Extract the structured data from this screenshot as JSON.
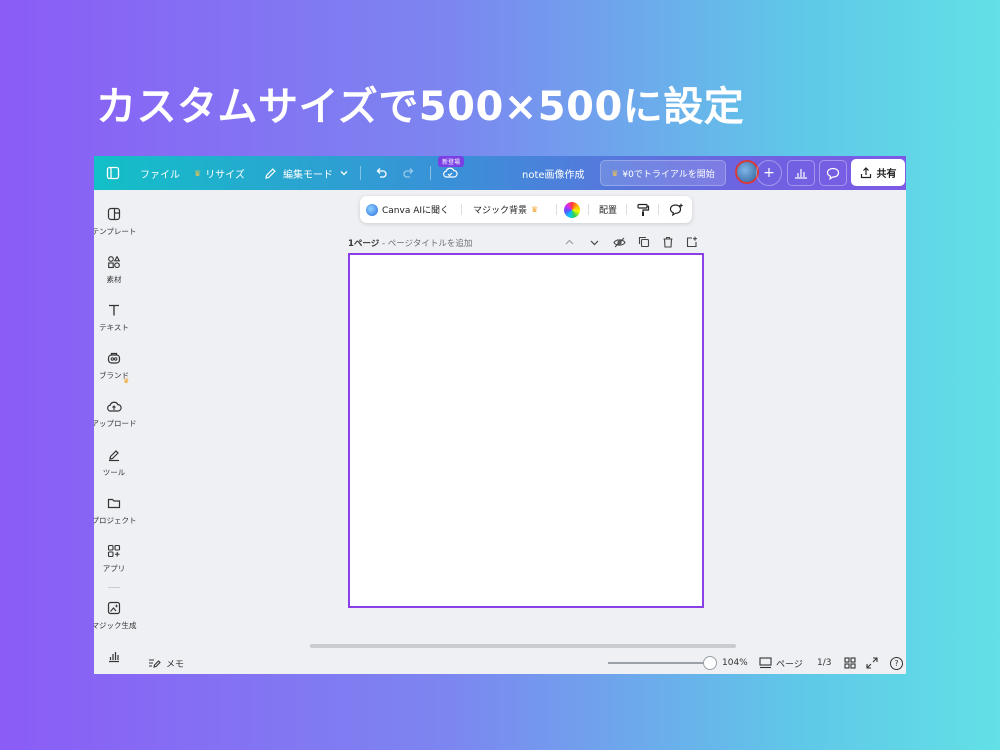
{
  "headline": "カスタムサイズで500×500に設定",
  "topbar": {
    "file": "ファイル",
    "resize": "リサイズ",
    "edit_mode": "編集モード",
    "new_badge": "新登場",
    "doc_title": "note画像作成",
    "trial": "¥0でトライアルを開始",
    "share": "共有"
  },
  "float_bar": {
    "canva_ai": "Canva AIに聞く",
    "magic_bg": "マジック背景",
    "arrange": "配置"
  },
  "page": {
    "label": "1ページ",
    "title_placeholder": "- ページタイトルを追加"
  },
  "sidebar": {
    "items": [
      {
        "label": "テンプレート",
        "icon": "template-icon"
      },
      {
        "label": "素材",
        "icon": "elements-icon"
      },
      {
        "label": "テキスト",
        "icon": "text-icon"
      },
      {
        "label": "ブランド",
        "icon": "brand-icon"
      },
      {
        "label": "アップロード",
        "icon": "upload-icon"
      },
      {
        "label": "ツール",
        "icon": "tool-icon"
      },
      {
        "label": "プロジェクト",
        "icon": "folder-icon"
      },
      {
        "label": "アプリ",
        "icon": "apps-icon"
      },
      {
        "label": "マジック生成",
        "icon": "magic-generate-icon"
      }
    ]
  },
  "bottombar": {
    "memo": "メモ",
    "zoom": "104%",
    "pages": "ページ",
    "page_count": "1/3",
    "help": "?"
  },
  "colors": {
    "canvas_border": "#8b3fe6",
    "crown": "#f2a227",
    "avatar_border": "#d83a3a"
  }
}
